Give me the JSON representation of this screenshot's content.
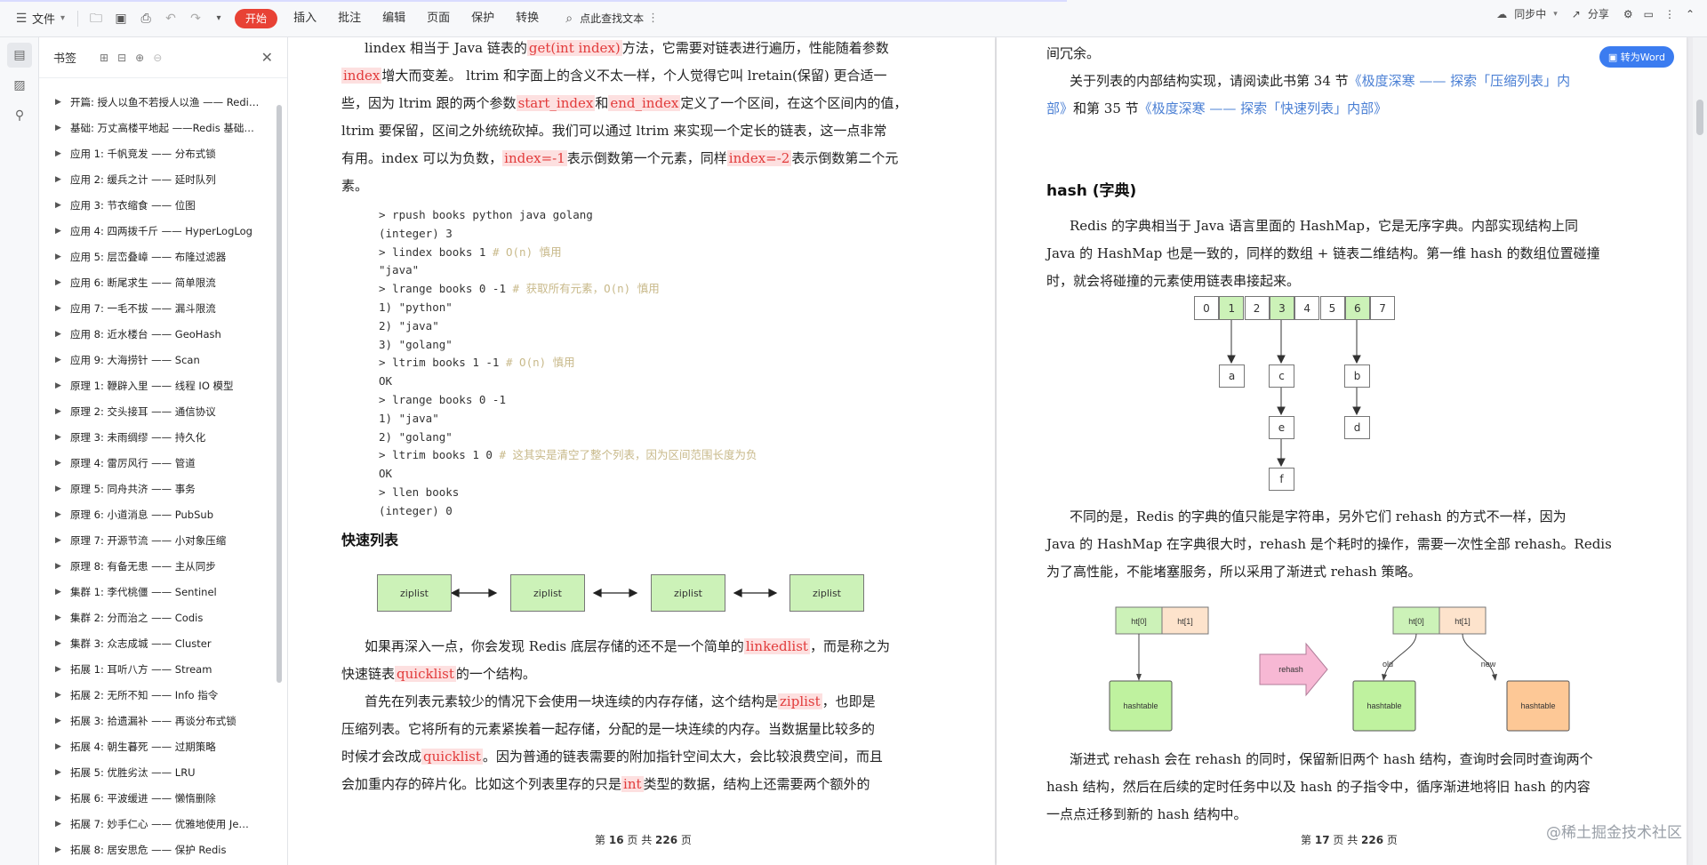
{
  "toolbar": {
    "file_label": "文件",
    "start_label": "开始",
    "menus": [
      "插入",
      "批注",
      "编辑",
      "页面",
      "保护",
      "转换"
    ],
    "search_label": "点此查找文本",
    "sync_label": "同步中",
    "share_label": "分享"
  },
  "bookmarks": {
    "title": "书签",
    "items": [
      "开篇: 授人以鱼不若授人以渔 —— Redi…",
      "基础: 万丈高楼平地起 ——Redis 基础…",
      "应用 1: 千帆竞发 —— 分布式锁",
      "应用 2: 缓兵之计 —— 延时队列",
      "应用 3: 节衣缩食 —— 位图",
      "应用 4: 四两拨千斤 —— HyperLogLog",
      "应用 5: 层峦叠嶂 —— 布隆过滤器",
      "应用 6: 断尾求生 —— 简单限流",
      "应用 7: 一毛不拔 —— 漏斗限流",
      "应用 8: 近水楼台 —— GeoHash",
      "应用 9: 大海捞针 —— Scan",
      "原理 1: 鞭辟入里 —— 线程 IO 模型",
      "原理 2: 交头接耳 —— 通信协议",
      "原理 3: 未雨绸缪 —— 持久化",
      "原理 4: 雷厉风行 —— 管道",
      "原理 5: 同舟共济 —— 事务",
      "原理 6: 小道消息 —— PubSub",
      "原理 7: 开源节流 —— 小对象压缩",
      "原理 8: 有备无患 —— 主从同步",
      "集群 1: 李代桃僵 —— Sentinel",
      "集群 2: 分而治之 —— Codis",
      "集群 3: 众志成城 —— Cluster",
      "拓展 1: 耳听八方 —— Stream",
      "拓展 2: 无所不知 —— Info 指令",
      "拓展 3: 拾遗漏补 —— 再谈分布式锁",
      "拓展 4: 朝生暮死 —— 过期策略",
      "拓展 5: 优胜劣汰 —— LRU",
      "拓展 6: 平波缓进 —— 懒惰删除",
      "拓展 7: 妙手仁心 —— 优雅地使用 Je…",
      "拓展 8: 居安思危 —— 保护 Redis"
    ]
  },
  "left_page": {
    "para1_a": "lindex 相当于 Java 链表的",
    "hl_get": "get(int index)",
    "para1_b": "方法，它需要对链表进行遍历，性能随着参数",
    "hl_index": "index",
    "para1_c": "增大而变差。 ltrim 和字面上的含义不太一样，个人觉得它叫 lretain(保留) 更合适一",
    "para1_d": "些，因为 ltrim 跟的两个参数",
    "hl_start": "start_index",
    "para1_e": "和",
    "hl_end": "end_index",
    "para1_f": "定义了一个区间，在这个区间内的值，",
    "para1_g": "ltrim 要保留，区间之外统统砍掉。我们可以通过 ltrim 来实现一个定长的链表，这一点非常",
    "para1_h": "有用。index 可以为负数，",
    "hl_neg1": "index=-1",
    "para1_i": "表示倒数第一个元素，同样",
    "hl_neg2": "index=-2",
    "para1_j": "表示倒数第二个元",
    "para1_k": "素。",
    "code": [
      {
        "c": "> rpush books python java golang",
        "m": ""
      },
      {
        "c": "(integer) 3",
        "m": ""
      },
      {
        "c": "> lindex books 1 ",
        "m": "# O(n) 慎用"
      },
      {
        "c": "\"java\"",
        "m": ""
      },
      {
        "c": "> lrange books 0 -1 ",
        "m": "# 获取所有元素，O(n) 慎用"
      },
      {
        "c": "1) \"python\"",
        "m": ""
      },
      {
        "c": "2) \"java\"",
        "m": ""
      },
      {
        "c": "3) \"golang\"",
        "m": ""
      },
      {
        "c": "> ltrim books 1 -1 ",
        "m": "# O(n) 慎用"
      },
      {
        "c": "OK",
        "m": ""
      },
      {
        "c": "> lrange books 0 -1",
        "m": ""
      },
      {
        "c": "1) \"java\"",
        "m": ""
      },
      {
        "c": "2) \"golang\"",
        "m": ""
      },
      {
        "c": "> ltrim books 1 0 ",
        "m": "# 这其实是清空了整个列表，因为区间范围长度为负"
      },
      {
        "c": "OK",
        "m": ""
      },
      {
        "c": "> llen books",
        "m": ""
      },
      {
        "c": "(integer) 0",
        "m": ""
      }
    ],
    "section_title": "快速列表",
    "ziplist_label": "ziplist",
    "para2_a": "如果再深入一点，你会发现 Redis 底层存储的还不是一个简单的",
    "hl_linkedlist": "linkedlist",
    "para2_b": "，而是称之为",
    "para2_c": "快速链表",
    "hl_quicklist": "quicklist",
    "para2_d": "的一个结构。",
    "para3_a": "首先在列表元素较少的情况下会使用一块连续的内存存储，这个结构是",
    "hl_ziplist": "ziplist",
    "para3_b": "，也即是",
    "para3_c": "压缩列表。它将所有的元素紧挨着一起存储，分配的是一块连续的内存。当数据量比较多的",
    "para3_d": "时候才会改成",
    "hl_quicklist2": "quicklist",
    "para3_e": "。因为普通的链表需要的附加指针空间太大，会比较浪费空间，而且",
    "para3_f": "会加重内存的碎片化。比如这个列表里存的只是",
    "hl_int": "int",
    "para3_g": "类型的数据，结构上还需要两个额外的",
    "footer_a": "第",
    "footer_page": "16",
    "footer_b": "页 共",
    "footer_total": "226",
    "footer_c": "页"
  },
  "right_page": {
    "to_word": "转为Word",
    "line0": "间冗余。",
    "para1_a": "关于列表的内部结构实现，请阅读此书第 34 节",
    "link1": "《极度深寒 —— 探索「压缩列表」内",
    "link1b": "部》",
    "para1_b": "和第 35 节",
    "link2": "《极度深寒 —— 探索「快速列表」内部》",
    "section_title": "hash (字典)",
    "para2_a": "Redis 的字典相当于 Java 语言里面的 HashMap，它是无序字典。内部实现结构上同",
    "para2_b": "Java 的 HashMap 也是一致的，同样的数组 + 链表二维结构。第一维 hash 的数组位置碰撞",
    "para2_c": "时，就会将碰撞的元素使用链表串接起来。",
    "cells": [
      "0",
      "1",
      "2",
      "3",
      "4",
      "5",
      "6",
      "7"
    ],
    "green_cells": [
      1,
      3,
      6
    ],
    "nodes": [
      "a",
      "c",
      "e",
      "f",
      "b",
      "d"
    ],
    "para3_a": "不同的是，Redis 的字典的值只能是字符串，另外它们 rehash 的方式不一样，因为",
    "para3_b": "Java 的 HashMap 在字典很大时，rehash 是个耗时的操作，需要一次性全部 rehash。Redis",
    "para3_c": "为了高性能，不能堵塞服务，所以采用了渐进式 rehash 策略。",
    "ht0": "ht[0]",
    "ht1": "ht[1]",
    "hashtable": "hashtable",
    "rehash": "rehash",
    "old": "old",
    "new": "new",
    "para4_a": "渐进式 rehash 会在 rehash 的同时，保留新旧两个 hash 结构，查询时会同时查询两个",
    "para4_b": "hash 结构，然后在后续的定时任务中以及 hash 的子指令中，循序渐进地将旧 hash 的内容",
    "para4_c": "一点点迁移到新的 hash 结构中。",
    "footer_a": "第",
    "footer_page": "17",
    "footer_b": "页 共",
    "footer_total": "226",
    "footer_c": "页",
    "watermark": "@稀土掘金技术社区"
  },
  "colors": {
    "start_button": "#e84235",
    "highlight_bg": "#fde0e0",
    "highlight_text": "#e23b3b",
    "link": "#4a7fd4",
    "node_green": "#ccf2b8",
    "node_orange": "#fdd0a4",
    "ht1_bg": "#fde3cc",
    "rehash_arrow": "#f7b8d4"
  }
}
